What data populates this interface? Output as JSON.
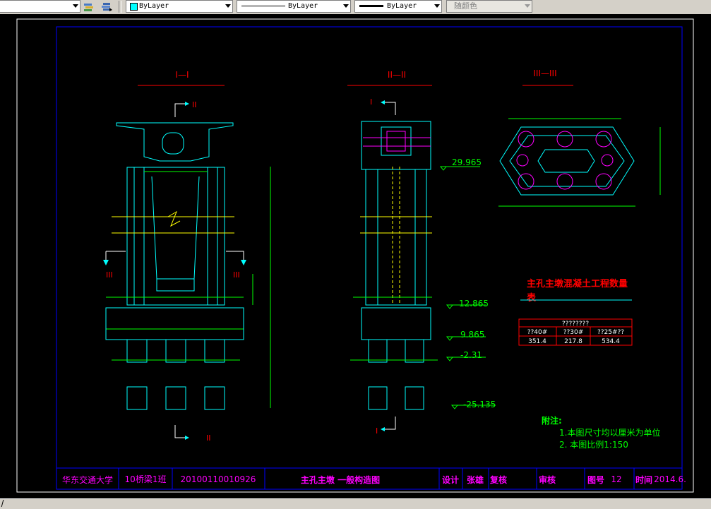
{
  "toolbar": {
    "layer_combo": {
      "value": "ByLayer"
    },
    "linetype_combo": {
      "value": "ByLayer"
    },
    "lineweight_combo": {
      "value": "ByLayer"
    },
    "plotstyle_combo": {
      "value": "随颜色"
    },
    "colors": {
      "color_swatch": "#00ffff",
      "toolbar_bg": "#d4d0c8"
    }
  },
  "drawing": {
    "sections": {
      "s1": "I—I",
      "s2": "II—II",
      "s3": "III—III"
    },
    "cut_marks": {
      "II": "II",
      "III": "III",
      "I": "I"
    },
    "elevations": [
      "29.965",
      "12.865",
      "9.865",
      "-2.31",
      "-25.135"
    ],
    "quantity_table": {
      "title_line1": "主孔主墩混凝土工程数量",
      "title_line2": "表",
      "header": "????????",
      "columns": [
        "??40#",
        "??30#",
        "??25#??"
      ],
      "values": [
        "351.4",
        "217.8",
        "534.4"
      ]
    },
    "notes": {
      "title": "附注:",
      "line1": "1.本图尺寸均以厘米为单位",
      "line2": "2.  本图比例1:150"
    },
    "title_block": {
      "school": "华东交通大学",
      "class": "10桥梁1班",
      "student_id": "20100110010926",
      "drawing_title": "主孔主墩  一般构造图",
      "design_label": "设计",
      "designer": "张雄",
      "check_label": "复核",
      "review_label": "审核",
      "drawing_no_label": "图号",
      "drawing_no": "12",
      "date_label": "时间",
      "date": "2014.6."
    },
    "colors": {
      "cyan": "#00ffff",
      "green": "#00ff00",
      "red": "#ff0000",
      "yellow": "#ffff00",
      "magenta": "#ff00ff",
      "blue": "#0000ff",
      "white": "#ffffff"
    }
  }
}
